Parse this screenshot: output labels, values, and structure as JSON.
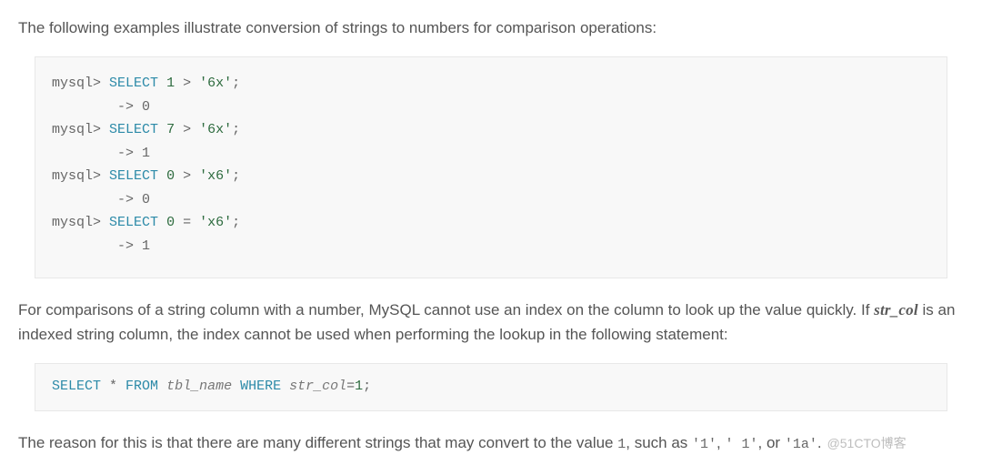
{
  "intro": "The following examples illustrate conversion of strings to numbers for comparison operations:",
  "code1": {
    "l1_prompt": "mysql>",
    "l1_kw": "SELECT",
    "l1_lhs": "1",
    "l1_op": ">",
    "l1_rhs": "'6x'",
    "l1_end": ";",
    "l2_arrow": "        ->",
    "l2_res": "0",
    "l3_prompt": "mysql>",
    "l3_kw": "SELECT",
    "l3_lhs": "7",
    "l3_op": ">",
    "l3_rhs": "'6x'",
    "l3_end": ";",
    "l4_arrow": "        ->",
    "l4_res": "1",
    "l5_prompt": "mysql>",
    "l5_kw": "SELECT",
    "l5_lhs": "0",
    "l5_op": ">",
    "l5_rhs": "'x6'",
    "l5_end": ";",
    "l6_arrow": "        ->",
    "l6_res": "0",
    "l7_prompt": "mysql>",
    "l7_kw": "SELECT",
    "l7_lhs": "0",
    "l7_op": "=",
    "l7_rhs": "'x6'",
    "l7_end": ";",
    "l8_arrow": "        ->",
    "l8_res": "1"
  },
  "para2_a": "For comparisons of a string column with a number, MySQL cannot use an index on the column to look up the value quickly. If ",
  "para2_code": "str_col",
  "para2_b": " is an indexed string column, the index cannot be used when performing the lookup in the following statement:",
  "code2": {
    "s1": "SELECT",
    "s2": " * ",
    "s3": "FROM",
    "s4": " ",
    "tbl": "tbl_name",
    "s5": " ",
    "s6": "WHERE",
    "s7": " ",
    "col": "str_col",
    "s8": "=",
    "val": "1",
    "s9": ";"
  },
  "para3_a": "The reason for this is that there are many different strings that may convert to the value ",
  "para3_v": "1",
  "para3_b": ", such as ",
  "para3_ex1": "'1'",
  "para3_c": ", ",
  "para3_ex2": "' 1'",
  "para3_d": ", or ",
  "para3_ex3": "'1a'",
  "para3_e": ".",
  "watermark": "@51CTO博客"
}
